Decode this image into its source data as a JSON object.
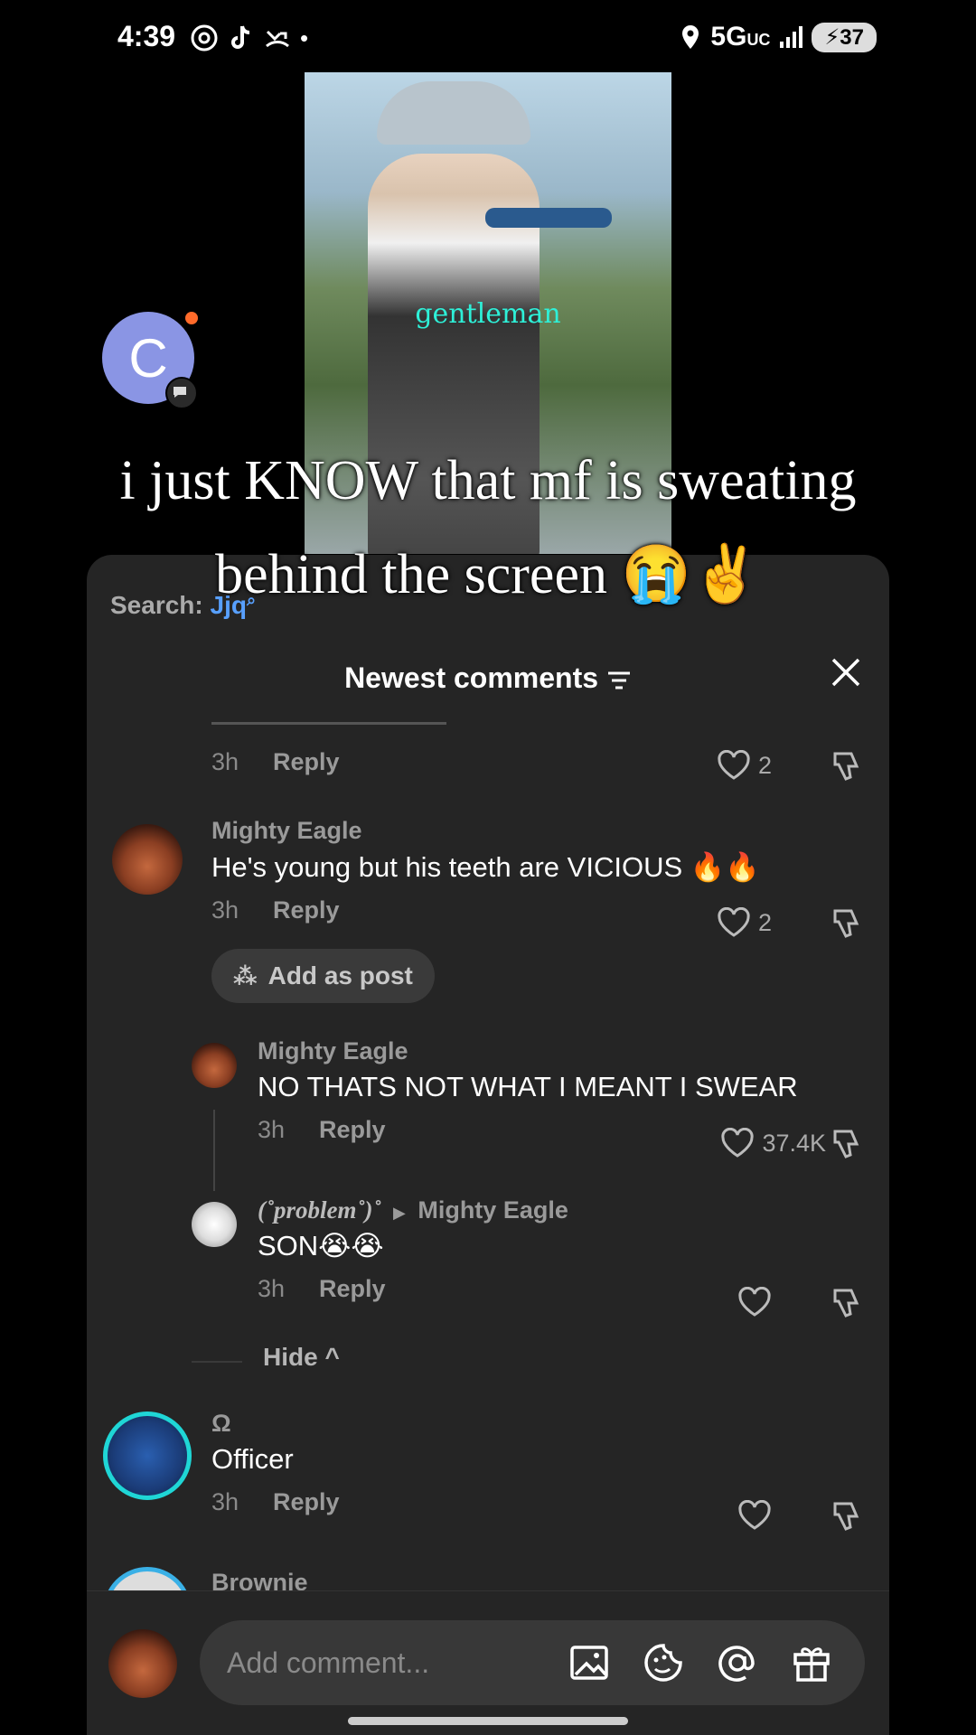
{
  "status_bar": {
    "time": "4:39",
    "network": "5G",
    "network_sub": "UC",
    "battery": "37"
  },
  "video": {
    "overlay_word": "gentleman"
  },
  "creator_avatar": {
    "letter": "C"
  },
  "caption": {
    "line1": "i just KNOW that mf is sweating",
    "line2": "behind the screen 😭✌️"
  },
  "sheet": {
    "search_label": "Search:",
    "search_query": "Jjq",
    "title": "Newest comments",
    "comments": [
      {
        "time": "3h",
        "reply": "Reply",
        "likes": "2"
      },
      {
        "name": "Mighty Eagle",
        "text": "He's young but his teeth are VICIOUS 🔥🔥",
        "time": "3h",
        "reply": "Reply",
        "likes": "2",
        "action": "Add as post"
      },
      {
        "name": "Mighty Eagle",
        "text": "NO THATS NOT WHAT I MEANT I SWEAR",
        "time": "3h",
        "reply": "Reply",
        "likes": "37.4K"
      },
      {
        "name": "(˚problem˚)˚",
        "reply_to": "Mighty Eagle",
        "text": "SON😭😭",
        "time": "3h",
        "reply": "Reply",
        "likes": ""
      },
      {
        "name": "Ω",
        "text": "Officer",
        "time": "3h",
        "reply": "Reply",
        "likes": ""
      },
      {
        "name": "Brownie"
      }
    ],
    "hide_label": "Hide",
    "input_placeholder": "Add comment..."
  },
  "icons": [
    "image-icon",
    "emoji-icon",
    "mention-icon",
    "gift-icon",
    "heart-icon",
    "dislike-icon",
    "close-icon",
    "filter-icon"
  ]
}
